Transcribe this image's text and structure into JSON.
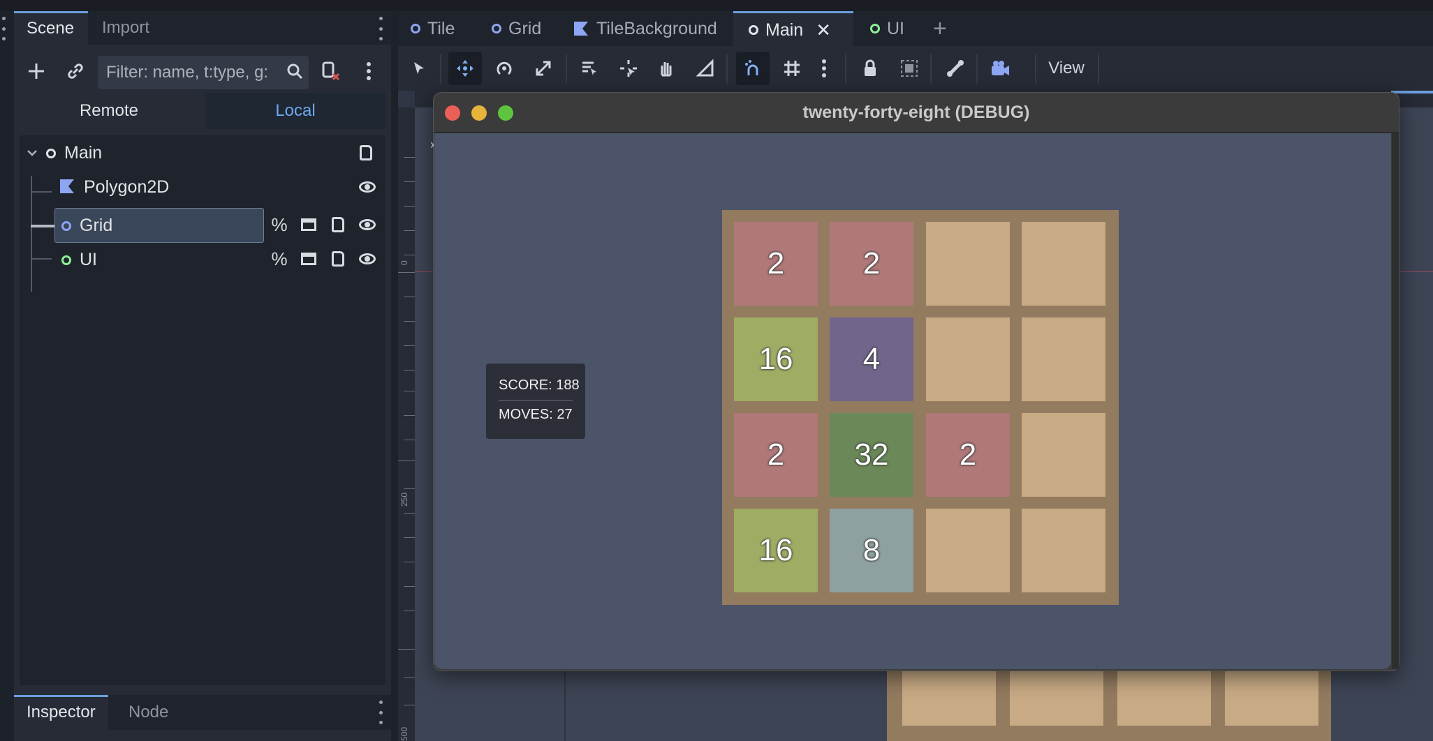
{
  "left_dock": {
    "tabs": [
      "Scene",
      "Import"
    ],
    "filter_placeholder": "Filter: name, t:type, g:",
    "remote_label": "Remote",
    "local_label": "Local",
    "tree": [
      {
        "name": "Main",
        "icon": "node2d-ring-icon",
        "color": "#e2e4e8"
      },
      {
        "name": "Polygon2D",
        "icon": "polygon-icon",
        "color": "#8da5f3"
      },
      {
        "name": "Grid",
        "icon": "node2d-ring-icon",
        "color": "#8da5f3",
        "selected": true
      },
      {
        "name": "UI",
        "icon": "control-ring-icon",
        "color": "#8eef97"
      }
    ],
    "percent": "%",
    "bottom_tabs": [
      "Inspector",
      "Node"
    ]
  },
  "editor": {
    "tabs": [
      {
        "label": "Tile",
        "icon": "node2d-ring-icon",
        "color": "#8da5f3"
      },
      {
        "label": "Grid",
        "icon": "node2d-ring-icon",
        "color": "#8da5f3"
      },
      {
        "label": "TileBackground",
        "icon": "polygon-icon",
        "color": "#8da5f3"
      },
      {
        "label": "Main",
        "icon": "node2d-ring-icon",
        "color": "#e2e4e8",
        "active": true
      },
      {
        "label": "UI",
        "icon": "control-ring-icon",
        "color": "#8eef97"
      }
    ],
    "close_glyph": "✕",
    "add_glyph": "+",
    "view_label": "View",
    "ruler_labels": [
      "0",
      "250",
      "500"
    ],
    "accent": "#6d9fe0"
  },
  "game_window": {
    "title": "twenty-forty-eight (DEBUG)",
    "score_label": "SCORE: 188",
    "moves_label": "MOVES:  27",
    "board": [
      [
        "2",
        "2",
        "",
        ""
      ],
      [
        "16",
        "4",
        "",
        ""
      ],
      [
        "2",
        "32",
        "2",
        ""
      ],
      [
        "16",
        "8",
        "",
        ""
      ]
    ],
    "tile_colors": {
      "": "#c8aa85",
      "2": "#b07878",
      "4": "#71658b",
      "8": "#8ea0a0",
      "16": "#9eac64",
      "32": "#6a8858"
    }
  }
}
